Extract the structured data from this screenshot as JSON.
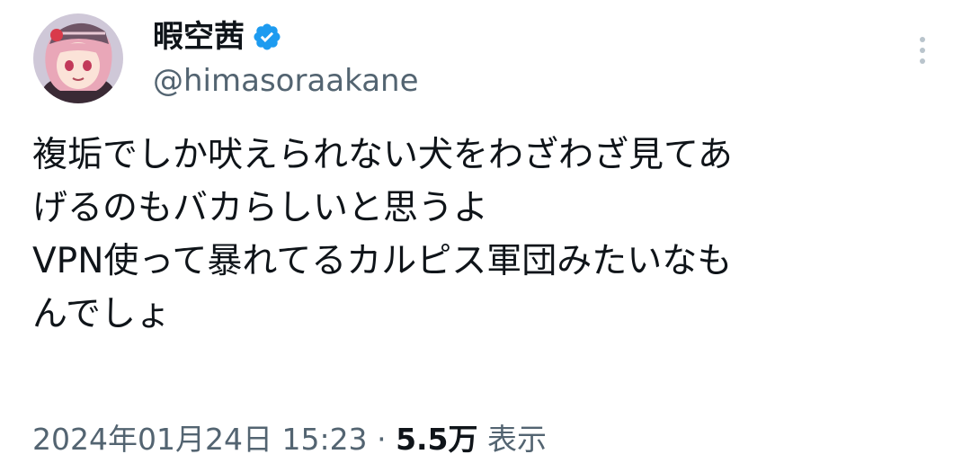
{
  "author": {
    "display_name": "暇空茜",
    "handle": "@himasoraakane",
    "verified": true,
    "avatar_icon": "anime-girl-avatar-icon",
    "verified_icon": "verified-badge-icon"
  },
  "menu": {
    "more_icon": "more-vertical-icon"
  },
  "tweet": {
    "lines": [
      "複垢でしか吠えられない犬をわざわざ見てあ",
      "げるのもバカらしいと思うよ",
      "VPN使って暴れてるカルピス軍団みたいなも",
      "んでしょ"
    ]
  },
  "meta": {
    "timestamp": "2024年01月24日 15:23",
    "separator": "·",
    "views_count": "5.5万",
    "views_label": "表示"
  },
  "colors": {
    "text": "#0f1419",
    "secondary": "#536471",
    "verified": "#1d9bf0"
  }
}
